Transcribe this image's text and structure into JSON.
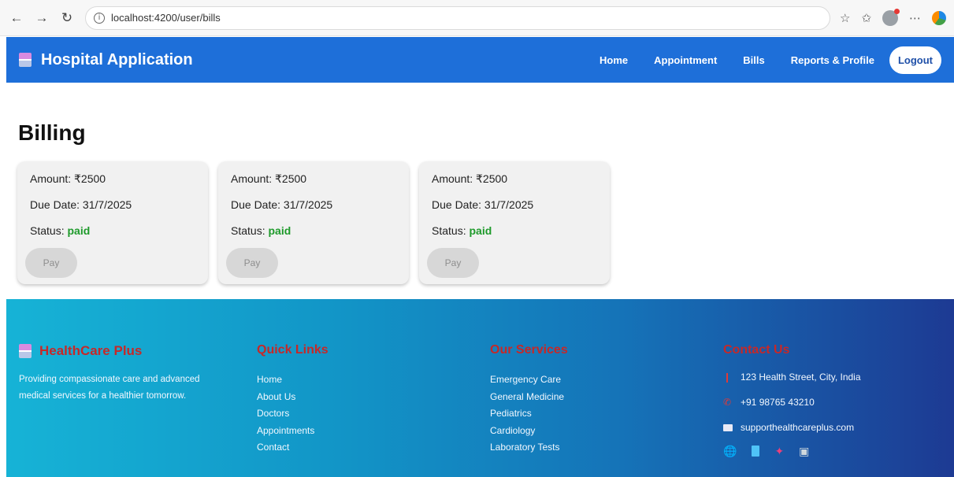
{
  "browser": {
    "url": "localhost:4200/user/bills"
  },
  "header": {
    "title": "Hospital Application",
    "nav": [
      "Home",
      "Appointment",
      "Bills",
      "Reports & Profile"
    ],
    "logout": "Logout"
  },
  "main": {
    "title": "Billing",
    "bills": [
      {
        "amount": "Amount: ₹2500",
        "due": "Due Date: 31/7/2025",
        "status_label": "Status:",
        "status": "paid",
        "pay": "Pay"
      },
      {
        "amount": "Amount: ₹2500",
        "due": "Due Date: 31/7/2025",
        "status_label": "Status:",
        "status": "paid",
        "pay": "Pay"
      },
      {
        "amount": "Amount: ₹2500",
        "due": "Due Date: 31/7/2025",
        "status_label": "Status:",
        "status": "paid",
        "pay": "Pay"
      }
    ]
  },
  "footer": {
    "brand": "HealthCare Plus",
    "description": "Providing compassionate care and advanced medical services for a healthier tomorrow.",
    "quick_links_title": "Quick Links",
    "quick_links": [
      "Home",
      "About Us",
      "Doctors",
      "Appointments",
      "Contact"
    ],
    "services_title": "Our Services",
    "services": [
      "Emergency Care",
      "General Medicine",
      "Pediatrics",
      "Cardiology",
      "Laboratory Tests"
    ],
    "contact_title": "Contact Us",
    "address": "123 Health Street, City, India",
    "phone": "+91 98765 43210",
    "email": "supporthealthcareplus.com"
  },
  "colors": {
    "header": "#1e6fd9",
    "status_paid": "#1e9a2b",
    "footer_heading": "#c62828"
  }
}
